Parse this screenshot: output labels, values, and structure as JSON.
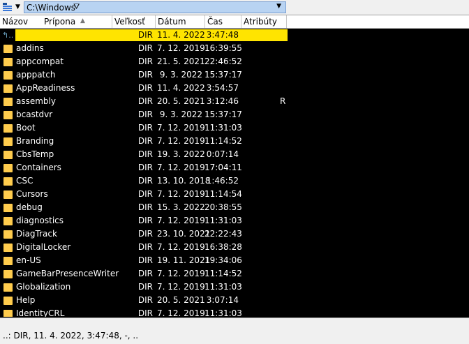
{
  "path_bar": {
    "path": "C:\\Windows",
    "filter_icon": "filter-icon",
    "dropdown_icon": "chevron-down-icon"
  },
  "columns": {
    "name": "Názov",
    "extension": "Prípona",
    "size": "Veľkosť",
    "date": "Dátum",
    "time": "Čas",
    "attributes": "Atribúty"
  },
  "rows": [
    {
      "name": "",
      "size": "DIR",
      "date": "11. 4. 2022",
      "time": "3:47:48",
      "attr": "",
      "icon": "up-folder-icon",
      "selected": true
    },
    {
      "name": "addins",
      "size": "DIR",
      "date": "7. 12. 2019",
      "time": "16:39:55",
      "attr": "",
      "icon": "folder-icon"
    },
    {
      "name": "appcompat",
      "size": "DIR",
      "date": "21. 5. 2021",
      "time": "22:46:52",
      "attr": "",
      "icon": "folder-icon"
    },
    {
      "name": "apppatch",
      "size": "DIR",
      "date": "9. 3. 2022",
      "time": "15:37:17",
      "attr": "",
      "icon": "folder-icon"
    },
    {
      "name": "AppReadiness",
      "size": "DIR",
      "date": "11. 4. 2022",
      "time": "3:54:57",
      "attr": "",
      "icon": "folder-icon"
    },
    {
      "name": "assembly",
      "size": "DIR",
      "date": "20. 5. 2021",
      "time": "3:12:46",
      "attr": "R",
      "icon": "folder-icon"
    },
    {
      "name": "bcastdvr",
      "size": "DIR",
      "date": "9. 3. 2022",
      "time": "15:37:17",
      "attr": "",
      "icon": "folder-icon"
    },
    {
      "name": "Boot",
      "size": "DIR",
      "date": "7. 12. 2019",
      "time": "11:31:03",
      "attr": "",
      "icon": "folder-icon"
    },
    {
      "name": "Branding",
      "size": "DIR",
      "date": "7. 12. 2019",
      "time": "11:14:52",
      "attr": "",
      "icon": "folder-icon"
    },
    {
      "name": "CbsTemp",
      "size": "DIR",
      "date": "19. 3. 2022",
      "time": "0:07:14",
      "attr": "",
      "icon": "folder-icon"
    },
    {
      "name": "Containers",
      "size": "DIR",
      "date": "7. 12. 2019",
      "time": "17:04:11",
      "attr": "",
      "icon": "folder-icon"
    },
    {
      "name": "CSC",
      "size": "DIR",
      "date": "13. 10. 2018",
      "time": "1:46:52",
      "attr": "",
      "icon": "folder-icon"
    },
    {
      "name": "Cursors",
      "size": "DIR",
      "date": "7. 12. 2019",
      "time": "11:14:54",
      "attr": "",
      "icon": "folder-icon"
    },
    {
      "name": "debug",
      "size": "DIR",
      "date": "15. 3. 2022",
      "time": "20:38:55",
      "attr": "",
      "icon": "folder-icon"
    },
    {
      "name": "diagnostics",
      "size": "DIR",
      "date": "7. 12. 2019",
      "time": "11:31:03",
      "attr": "",
      "icon": "folder-icon"
    },
    {
      "name": "DiagTrack",
      "size": "DIR",
      "date": "23. 10. 2021",
      "time": "22:22:43",
      "attr": "",
      "icon": "folder-icon"
    },
    {
      "name": "DigitalLocker",
      "size": "DIR",
      "date": "7. 12. 2019",
      "time": "16:38:28",
      "attr": "",
      "icon": "folder-icon"
    },
    {
      "name": "en-US",
      "size": "DIR",
      "date": "19. 11. 2021",
      "time": "19:34:06",
      "attr": "",
      "icon": "folder-icon"
    },
    {
      "name": "GameBarPresenceWriter",
      "size": "DIR",
      "date": "7. 12. 2019",
      "time": "11:14:52",
      "attr": "",
      "icon": "folder-icon"
    },
    {
      "name": "Globalization",
      "size": "DIR",
      "date": "7. 12. 2019",
      "time": "11:31:03",
      "attr": "",
      "icon": "folder-icon"
    },
    {
      "name": "Help",
      "size": "DIR",
      "date": "20. 5. 2021",
      "time": "3:07:14",
      "attr": "",
      "icon": "folder-icon"
    },
    {
      "name": "IdentityCRL",
      "size": "DIR",
      "date": "7. 12. 2019",
      "time": "11:31:03",
      "attr": "",
      "icon": "folder-icon"
    }
  ],
  "status": {
    "text": "..: DIR, 11. 4. 2022, 3:47:48, -, .."
  },
  "colors": {
    "background": "#000000",
    "selection": "#ffe400",
    "folder": "#ffcc4d",
    "path_field": "#b8d3f2"
  }
}
